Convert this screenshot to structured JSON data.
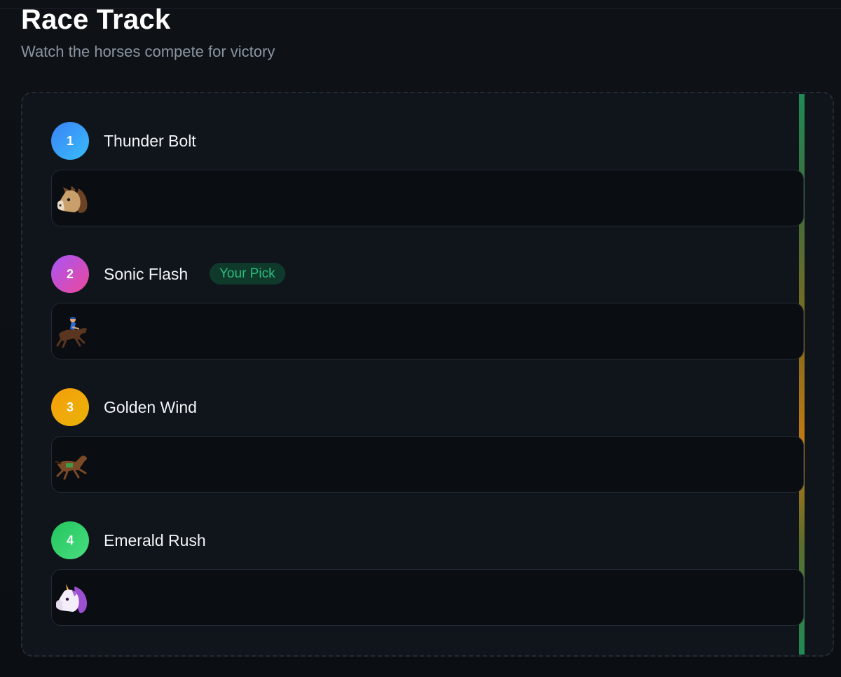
{
  "header": {
    "title": "Race Track",
    "subtitle": "Watch the horses compete for victory"
  },
  "lanes": [
    {
      "number": "1",
      "name": "Thunder Bolt",
      "runner_icon": "horse-face-icon",
      "badge": "",
      "color_from": "#3b82f6",
      "color_to": "#38bdf8",
      "progress": 0
    },
    {
      "number": "2",
      "name": "Sonic Flash",
      "runner_icon": "horse-racing-jockey-icon",
      "badge": "Your Pick",
      "color_from": "#a855f7",
      "color_to": "#ec4899",
      "progress": 0
    },
    {
      "number": "3",
      "name": "Golden Wind",
      "runner_icon": "running-horse-icon",
      "badge": "",
      "color_from": "#f59e0b",
      "color_to": "#eab308",
      "progress": 0
    },
    {
      "number": "4",
      "name": "Emerald Rush",
      "runner_icon": "unicorn-icon",
      "badge": "",
      "color_from": "#22c55e",
      "color_to": "#4ade80",
      "progress": 0
    }
  ],
  "colors": {
    "background": "#0d1116",
    "panel": "#10151b",
    "lane_track": "#0a0d11",
    "badge_bg": "#0f3a2b",
    "badge_text": "#2bbd7e"
  }
}
